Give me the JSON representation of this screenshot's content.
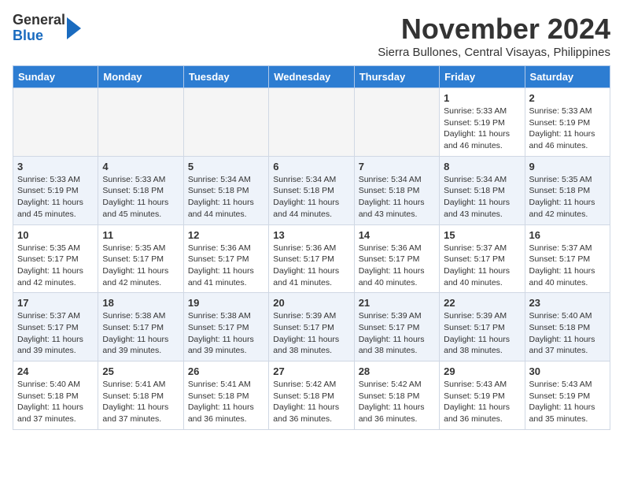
{
  "header": {
    "logo_line1": "General",
    "logo_line2": "Blue",
    "month": "November 2024",
    "location": "Sierra Bullones, Central Visayas, Philippines"
  },
  "weekdays": [
    "Sunday",
    "Monday",
    "Tuesday",
    "Wednesday",
    "Thursday",
    "Friday",
    "Saturday"
  ],
  "weeks": [
    [
      {
        "day": "",
        "info": ""
      },
      {
        "day": "",
        "info": ""
      },
      {
        "day": "",
        "info": ""
      },
      {
        "day": "",
        "info": ""
      },
      {
        "day": "",
        "info": ""
      },
      {
        "day": "1",
        "info": "Sunrise: 5:33 AM\nSunset: 5:19 PM\nDaylight: 11 hours and 46 minutes."
      },
      {
        "day": "2",
        "info": "Sunrise: 5:33 AM\nSunset: 5:19 PM\nDaylight: 11 hours and 46 minutes."
      }
    ],
    [
      {
        "day": "3",
        "info": "Sunrise: 5:33 AM\nSunset: 5:19 PM\nDaylight: 11 hours and 45 minutes."
      },
      {
        "day": "4",
        "info": "Sunrise: 5:33 AM\nSunset: 5:18 PM\nDaylight: 11 hours and 45 minutes."
      },
      {
        "day": "5",
        "info": "Sunrise: 5:34 AM\nSunset: 5:18 PM\nDaylight: 11 hours and 44 minutes."
      },
      {
        "day": "6",
        "info": "Sunrise: 5:34 AM\nSunset: 5:18 PM\nDaylight: 11 hours and 44 minutes."
      },
      {
        "day": "7",
        "info": "Sunrise: 5:34 AM\nSunset: 5:18 PM\nDaylight: 11 hours and 43 minutes."
      },
      {
        "day": "8",
        "info": "Sunrise: 5:34 AM\nSunset: 5:18 PM\nDaylight: 11 hours and 43 minutes."
      },
      {
        "day": "9",
        "info": "Sunrise: 5:35 AM\nSunset: 5:18 PM\nDaylight: 11 hours and 42 minutes."
      }
    ],
    [
      {
        "day": "10",
        "info": "Sunrise: 5:35 AM\nSunset: 5:17 PM\nDaylight: 11 hours and 42 minutes."
      },
      {
        "day": "11",
        "info": "Sunrise: 5:35 AM\nSunset: 5:17 PM\nDaylight: 11 hours and 42 minutes."
      },
      {
        "day": "12",
        "info": "Sunrise: 5:36 AM\nSunset: 5:17 PM\nDaylight: 11 hours and 41 minutes."
      },
      {
        "day": "13",
        "info": "Sunrise: 5:36 AM\nSunset: 5:17 PM\nDaylight: 11 hours and 41 minutes."
      },
      {
        "day": "14",
        "info": "Sunrise: 5:36 AM\nSunset: 5:17 PM\nDaylight: 11 hours and 40 minutes."
      },
      {
        "day": "15",
        "info": "Sunrise: 5:37 AM\nSunset: 5:17 PM\nDaylight: 11 hours and 40 minutes."
      },
      {
        "day": "16",
        "info": "Sunrise: 5:37 AM\nSunset: 5:17 PM\nDaylight: 11 hours and 40 minutes."
      }
    ],
    [
      {
        "day": "17",
        "info": "Sunrise: 5:37 AM\nSunset: 5:17 PM\nDaylight: 11 hours and 39 minutes."
      },
      {
        "day": "18",
        "info": "Sunrise: 5:38 AM\nSunset: 5:17 PM\nDaylight: 11 hours and 39 minutes."
      },
      {
        "day": "19",
        "info": "Sunrise: 5:38 AM\nSunset: 5:17 PM\nDaylight: 11 hours and 39 minutes."
      },
      {
        "day": "20",
        "info": "Sunrise: 5:39 AM\nSunset: 5:17 PM\nDaylight: 11 hours and 38 minutes."
      },
      {
        "day": "21",
        "info": "Sunrise: 5:39 AM\nSunset: 5:17 PM\nDaylight: 11 hours and 38 minutes."
      },
      {
        "day": "22",
        "info": "Sunrise: 5:39 AM\nSunset: 5:17 PM\nDaylight: 11 hours and 38 minutes."
      },
      {
        "day": "23",
        "info": "Sunrise: 5:40 AM\nSunset: 5:18 PM\nDaylight: 11 hours and 37 minutes."
      }
    ],
    [
      {
        "day": "24",
        "info": "Sunrise: 5:40 AM\nSunset: 5:18 PM\nDaylight: 11 hours and 37 minutes."
      },
      {
        "day": "25",
        "info": "Sunrise: 5:41 AM\nSunset: 5:18 PM\nDaylight: 11 hours and 37 minutes."
      },
      {
        "day": "26",
        "info": "Sunrise: 5:41 AM\nSunset: 5:18 PM\nDaylight: 11 hours and 36 minutes."
      },
      {
        "day": "27",
        "info": "Sunrise: 5:42 AM\nSunset: 5:18 PM\nDaylight: 11 hours and 36 minutes."
      },
      {
        "day": "28",
        "info": "Sunrise: 5:42 AM\nSunset: 5:18 PM\nDaylight: 11 hours and 36 minutes."
      },
      {
        "day": "29",
        "info": "Sunrise: 5:43 AM\nSunset: 5:19 PM\nDaylight: 11 hours and 36 minutes."
      },
      {
        "day": "30",
        "info": "Sunrise: 5:43 AM\nSunset: 5:19 PM\nDaylight: 11 hours and 35 minutes."
      }
    ]
  ]
}
